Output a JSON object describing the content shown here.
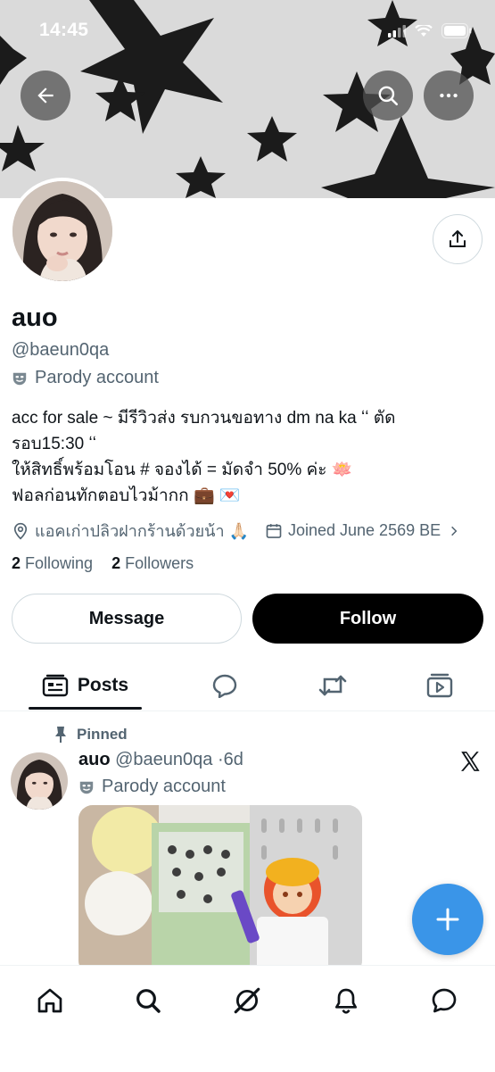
{
  "status_bar": {
    "time": "14:45"
  },
  "profile": {
    "display_name": "auo",
    "handle": "@baeun0qa",
    "account_label": "Parody account",
    "bio_lines": [
      "acc for sale ~ มีรีวิวส่ง รบกวนขอทาง dm na ka ʻʻ ตัด",
      "รอบ15:30 ʻʻ",
      "ให้สิทธิ์พร้อมโอน # จองได้ = มัดจำ 50% ค่ะ 🪷",
      "ฟอลก่อนทักตอบไวม้ากก 💼 💌"
    ],
    "location": "แอคเก่าปลิวฝากร้านด้วยน้า 🙏🏻",
    "joined": "Joined June 2569 BE",
    "following_count": "2",
    "following_label": "Following",
    "followers_count": "2",
    "followers_label": "Followers"
  },
  "actions": {
    "message_label": "Message",
    "follow_label": "Follow"
  },
  "tabs": [
    {
      "label": "Posts",
      "icon": "posts-icon",
      "active": true
    },
    {
      "label": "",
      "icon": "replies-icon"
    },
    {
      "label": "",
      "icon": "reposts-icon"
    },
    {
      "label": "",
      "icon": "media-icon"
    }
  ],
  "pinned_post": {
    "pinned_label": "Pinned",
    "author_name": "auo",
    "author_handle": "@baeun0qa",
    "time_ago": "6d",
    "account_label": "Parody account"
  },
  "bottom_nav": [
    "home-icon",
    "search-icon",
    "grok-icon",
    "notifications-icon",
    "messages-icon"
  ],
  "colors": {
    "accent": "#3a95e8",
    "secondary_text": "#536471",
    "follow_bg": "#000000"
  }
}
